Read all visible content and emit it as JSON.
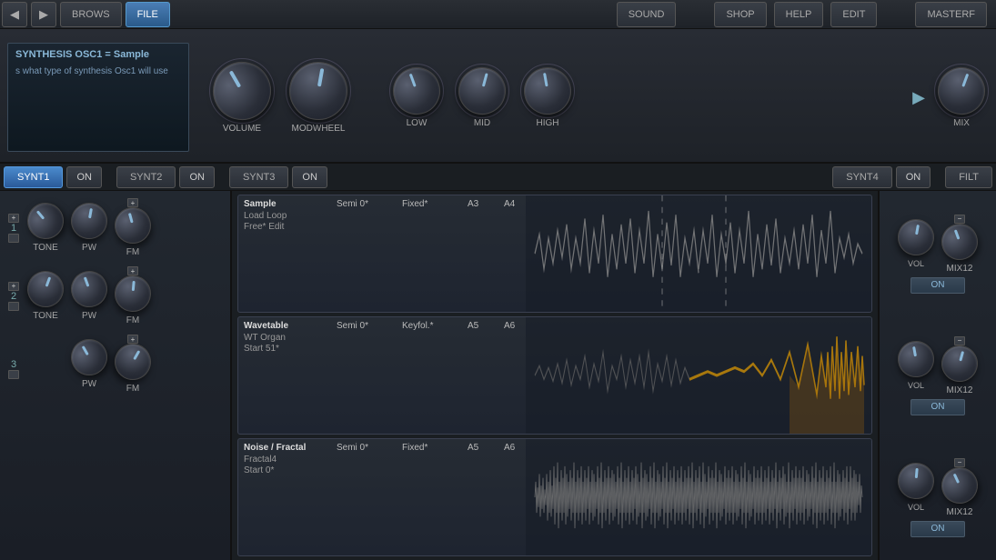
{
  "topbar": {
    "back_label": "◀",
    "forward_label": "▶",
    "browse_label": "BROWS",
    "file_label": "FILE",
    "sound_label": "SOUND",
    "shop_label": "SHOP",
    "help_label": "HELP",
    "edit_label": "EDIT",
    "master_label": "MASTERF"
  },
  "info_panel": {
    "title": "SYNTHESIS OSC1 = Sample",
    "desc": "s what type of synthesis Osc1 will use"
  },
  "knobs": [
    {
      "label": "VOLUME",
      "size": "large"
    },
    {
      "label": "MODWHEEL",
      "size": "large"
    },
    {
      "label": "LOW",
      "size": "medium"
    },
    {
      "label": "MID",
      "size": "medium"
    },
    {
      "label": "HIGH",
      "size": "medium"
    },
    {
      "label": "MIX",
      "size": "medium"
    }
  ],
  "tabs": [
    {
      "label": "SYNT1",
      "active": true,
      "on_label": "ON"
    },
    {
      "label": "SYNT2",
      "active": false,
      "on_label": "ON"
    },
    {
      "label": "SYNT3",
      "active": false,
      "on_label": "ON"
    },
    {
      "label": "SYNT4",
      "active": false,
      "on_label": "ON"
    },
    {
      "label": "FILT",
      "active": false
    }
  ],
  "synth_slots": [
    {
      "type": "Sample",
      "semi": "Semi 0*",
      "keyfol": "Fixed*",
      "note1": "A3",
      "note2": "A4",
      "sub1": "Load    Loop",
      "sub2": "Free*   Edit",
      "waveform_type": "sample"
    },
    {
      "type": "Wavetable",
      "semi": "Semi 0*",
      "keyfol": "Keyfol.*",
      "note1": "A5",
      "note2": "A6",
      "sub1": "WT Organ",
      "sub2": "Start 51*",
      "waveform_type": "wavetable"
    },
    {
      "type": "Noise / Fractal",
      "semi": "Semi 0*",
      "keyfol": "Fixed*",
      "note1": "A5",
      "note2": "A6",
      "sub1": "Fractal4",
      "sub2": "Start 0*",
      "waveform_type": "noise"
    }
  ],
  "right_slots": [
    {
      "vol_label": "VOL",
      "mix_label": "MIX12",
      "on_label": "ON"
    },
    {
      "vol_label": "VOL",
      "mix_label": "MIX12",
      "on_label": "ON"
    },
    {
      "vol_label": "VOL",
      "mix_label": "MIX12",
      "on_label": "ON"
    }
  ],
  "osc_rows": [
    {
      "num": "1",
      "knob1_label": "TONE",
      "knob2_label": "PW",
      "knob3_label": "FM"
    },
    {
      "num": "2",
      "knob1_label": "TONE",
      "knob2_label": "PW",
      "knob3_label": "FM"
    },
    {
      "num": "3",
      "knob1_label": "",
      "knob2_label": "PW",
      "knob3_label": "FM"
    }
  ]
}
